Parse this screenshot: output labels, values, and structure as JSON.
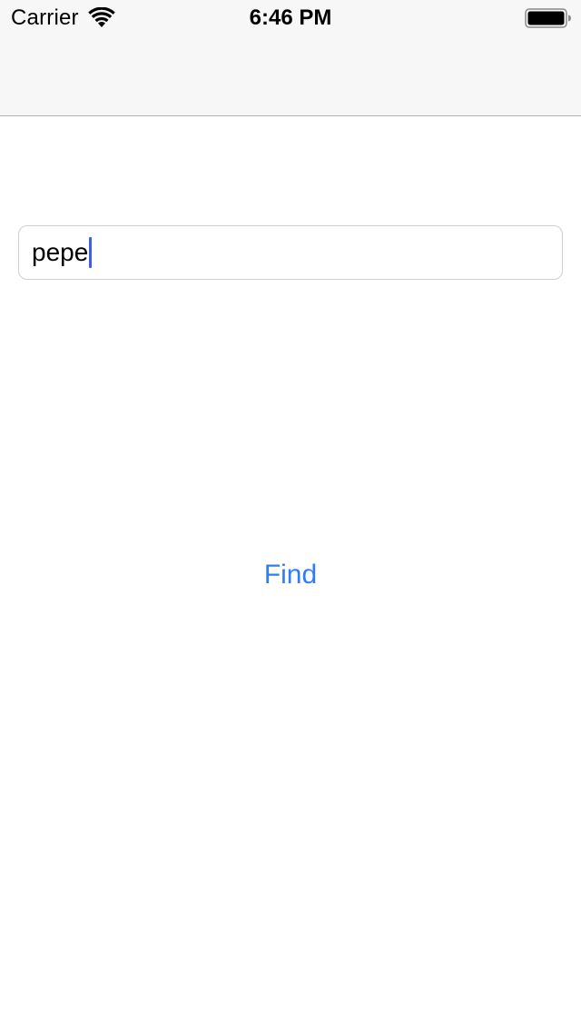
{
  "status_bar": {
    "carrier": "Carrier",
    "time": "6:46 PM",
    "wifi_icon": "wifi-icon",
    "battery_icon": "battery-icon"
  },
  "search": {
    "value": "pepe",
    "caret_color": "#3f5fe0"
  },
  "actions": {
    "find_label": "Find",
    "accent_color": "#2f7cf6"
  }
}
